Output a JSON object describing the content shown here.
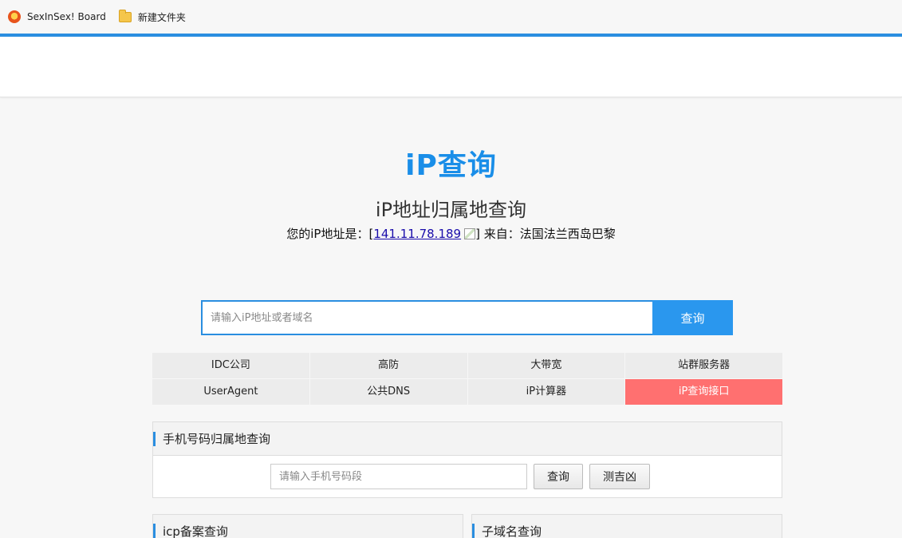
{
  "bookmarks": [
    {
      "label": "SexInSex! Board",
      "icon": "site-favicon-icon"
    },
    {
      "label": "新建文件夹",
      "icon": "folder-icon"
    }
  ],
  "logo": "iP查询",
  "subtitle": "iP地址归属地查询",
  "ip_info": {
    "prefix": "您的iP地址是：[",
    "ip": "141.11.78.189",
    "suffix": "] 来自：法国法兰西岛巴黎"
  },
  "search": {
    "placeholder": "请输入iP地址或者域名",
    "button": "查询"
  },
  "quick_links": [
    {
      "label": "IDC公司",
      "highlight": false
    },
    {
      "label": "高防",
      "highlight": false
    },
    {
      "label": "大带宽",
      "highlight": false
    },
    {
      "label": "站群服务器",
      "highlight": false
    },
    {
      "label": "UserAgent",
      "highlight": false
    },
    {
      "label": "公共DNS",
      "highlight": false
    },
    {
      "label": "iP计算器",
      "highlight": false
    },
    {
      "label": "iP查询接口",
      "highlight": true
    }
  ],
  "phone_panel": {
    "title": "手机号码归属地查询",
    "placeholder": "请输入手机号码段",
    "query_button": "查询",
    "fortune_button": "测吉凶"
  },
  "icp_panel": {
    "title": "icp备案查询"
  },
  "subdomain_panel": {
    "title": "子域名查询"
  },
  "colors": {
    "accent": "#2a8ee0",
    "logo": "#1a8ee8",
    "highlight": "#ff7070"
  }
}
